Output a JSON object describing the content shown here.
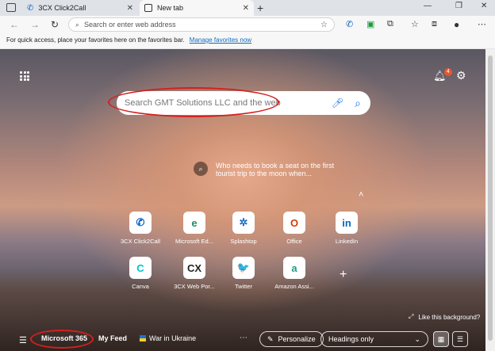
{
  "tabs": [
    {
      "label": "3CX Click2Call",
      "active": false
    },
    {
      "label": "New tab",
      "active": true
    }
  ],
  "address_bar": {
    "placeholder": "Search or enter web address"
  },
  "favorites_bar": {
    "text": "For quick access, place your favorites here on the favorites bar.",
    "link": "Manage favorites now"
  },
  "notifications": {
    "count": "4"
  },
  "search": {
    "placeholder": "Search GMT Solutions LLC and the web"
  },
  "background_question": "Who needs to book a seat on the first tourist trip to the moon when...",
  "quick_links": [
    {
      "label": "3CX Click2Call",
      "icon": "phone-icon",
      "glyph": "✆",
      "color": "#0a63c9"
    },
    {
      "label": "Microsoft Ed...",
      "icon": "edge-icon",
      "glyph": "e",
      "color": "#1b8f6b"
    },
    {
      "label": "Splashtop",
      "icon": "splashtop-icon",
      "glyph": "✲",
      "color": "#1c6fc2"
    },
    {
      "label": "Office",
      "icon": "office-icon",
      "glyph": "O",
      "color": "#d83b01"
    },
    {
      "label": "LinkedIn",
      "icon": "linkedin-icon",
      "glyph": "in",
      "color": "#0a66c2"
    },
    {
      "label": "Canva",
      "icon": "canva-icon",
      "glyph": "C",
      "color": "#00c4cc"
    },
    {
      "label": "3CX Web Por...",
      "icon": "3cx-icon",
      "glyph": "CX",
      "color": "#222222"
    },
    {
      "label": "Twitter",
      "icon": "twitter-icon",
      "glyph": "🐦",
      "color": "#1d9bf0"
    },
    {
      "label": "Amazon Assi...",
      "icon": "amazon-assistant-icon",
      "glyph": "a",
      "color": "#1a9c8c"
    }
  ],
  "like_background": "Like this background?",
  "bottom_bar": {
    "microsoft365": "Microsoft 365",
    "my_feed": "My Feed",
    "war_in_ukraine": "War in Ukraine",
    "personalize": "Personalize",
    "headings_select": "Headings only"
  }
}
